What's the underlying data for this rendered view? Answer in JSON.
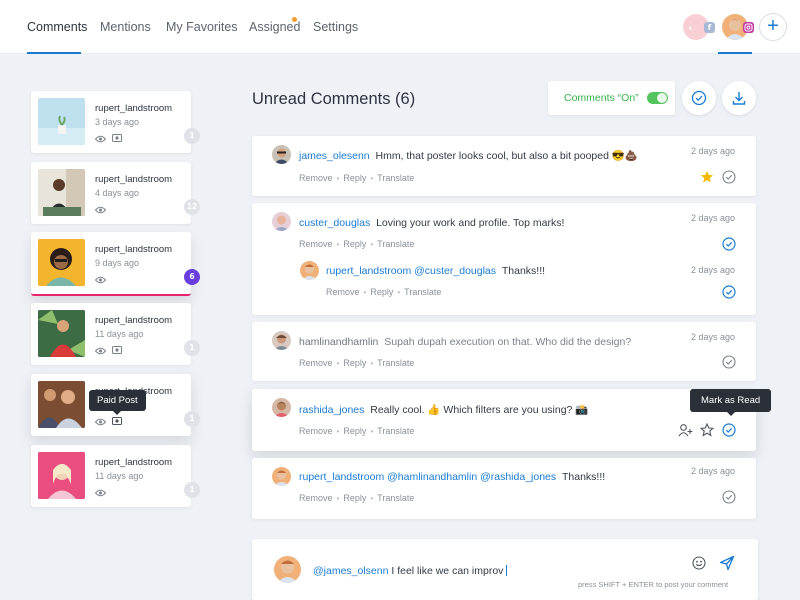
{
  "nav": {
    "tabs": [
      {
        "label": "Comments",
        "active": true
      },
      {
        "label": "Mentions"
      },
      {
        "label": "My Favorites"
      },
      {
        "label": "Assigned",
        "has_notification_dot": true
      },
      {
        "label": "Settings"
      }
    ],
    "add_button_label": "+",
    "accounts": [
      {
        "name": "account-avatar-1",
        "badge_icon": "facebook-icon"
      },
      {
        "name": "account-avatar-2",
        "badge_icon": "instagram-icon",
        "active": true
      }
    ]
  },
  "posts": [
    {
      "user": "rupert_landstroom",
      "time": "3 days ago",
      "count": "1",
      "has_image_icon": true
    },
    {
      "user": "rupert_landstroom",
      "time": "4 days ago",
      "count": "12",
      "has_image_icon": false
    },
    {
      "user": "rupert_landstroom",
      "time": "9 days ago",
      "count": "6",
      "has_image_icon": false,
      "active": true
    },
    {
      "user": "rupert_landstroom",
      "time": "11 days ago",
      "count": "1",
      "has_image_icon": true
    },
    {
      "user": "rupert_landstroom",
      "time": "",
      "count": "1",
      "has_image_icon": true
    },
    {
      "user": "rupert_landstroom",
      "time": "11 days ago",
      "count": "1",
      "has_image_icon": false
    }
  ],
  "tooltips": {
    "paid_post": "Paid Post",
    "mark_as_read": "Mark as Read"
  },
  "header": {
    "title": "Unread Comments (6)",
    "toggle_label": "Comments “On”",
    "toggle_on": true
  },
  "comments": [
    {
      "user": "james_olesenn",
      "text": "Hmm, that poster looks cool, but also a bit pooped 😎💩",
      "time": "2 days ago",
      "actions": [
        "Remove",
        "Reply",
        "Translate"
      ],
      "starred": true,
      "read": false
    },
    {
      "user": "custer_douglas",
      "text": "Loving your work and profile. Top marks!",
      "time": "2 days ago",
      "actions": [
        "Remove",
        "Reply",
        "Translate"
      ],
      "read": true,
      "reply": {
        "user": "rupert_landstroom",
        "mention": "@custer_douglas",
        "text": "Thanks!!!",
        "time": "2 days ago",
        "actions": [
          "Remove",
          "Reply",
          "Translate"
        ],
        "read": true
      }
    },
    {
      "user": "hamlinandhamlin",
      "text": "Supah dupah execution on that. Who did the design?",
      "time": "2 days ago",
      "actions": [
        "Remove",
        "Reply",
        "Translate"
      ],
      "muted": true,
      "read": false
    },
    {
      "user": "rashida_jones",
      "text": "Really cool. 👍 Which filters are you using? 📸",
      "time": "2 days ago",
      "actions": [
        "Remove",
        "Reply",
        "Translate"
      ],
      "read": true
    },
    {
      "user": "rupert_landstroom",
      "mentions": "@hamlinandhamlin @rashida_jones",
      "text": "Thanks!!!",
      "time": "2 days ago",
      "actions": [
        "Remove",
        "Reply",
        "Translate"
      ],
      "read": false
    }
  ],
  "composer": {
    "mention": "@james_olsenn",
    "text": "I feel like we can improv",
    "hint": "press SHIFT + ENTER to post your comment"
  },
  "colors": {
    "accent": "#1a7bd3",
    "toggle_green": "#37b34a",
    "active_border": "#e6246f",
    "badge_active": "#6a3fe0",
    "star": "#f5b800"
  }
}
